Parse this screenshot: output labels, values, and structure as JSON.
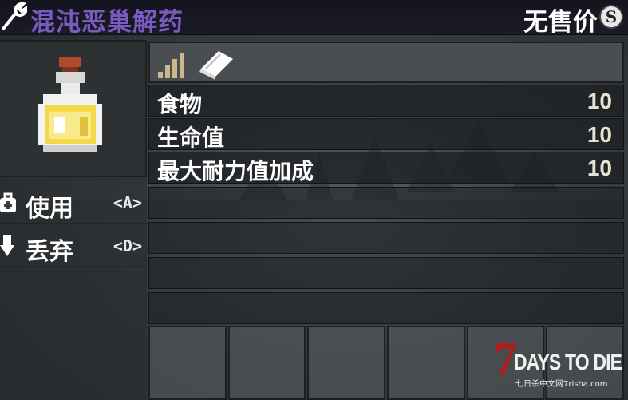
{
  "header": {
    "title": "混沌恶巢解药",
    "price_label": "无售价",
    "coin_symbol": "S"
  },
  "actions": [
    {
      "label": "使用",
      "key": "<A>",
      "icon": "backpack-icon"
    },
    {
      "label": "丢弃",
      "key": "<D>",
      "icon": "down-arrow-icon"
    }
  ],
  "item": {
    "icon": "potion-bottle-icon",
    "tier_icon": "quality-bars-icon",
    "book_icon": "book-icon"
  },
  "stats": [
    {
      "name": "食物",
      "value": "10"
    },
    {
      "name": "生命值",
      "value": "10"
    },
    {
      "name": "最大耐力值加成",
      "value": "10"
    }
  ],
  "watermark": {
    "logo_number": "7",
    "game_title": "DAYS TO DIE",
    "site_text": "七日杀中文网7risha.com"
  },
  "colors": {
    "title": "#7a5cc0",
    "stat_value": "#e8e2d0",
    "watermark_red": "#b31c1c"
  }
}
